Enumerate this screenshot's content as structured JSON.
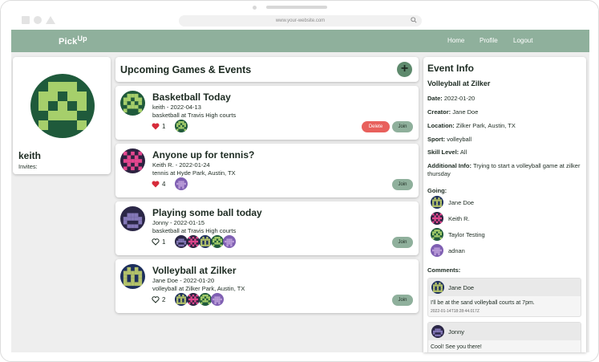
{
  "browser": {
    "url": "www.your-website.com"
  },
  "nav": {
    "brand": "Pick",
    "brand_sup": "Up",
    "links": [
      "Home",
      "Profile",
      "Logout"
    ]
  },
  "profile": {
    "name": "keith",
    "invites_label": "Invites:"
  },
  "feed": {
    "header": "Upcoming Games & Events",
    "add_label": "+",
    "games": [
      {
        "title": "Basketball Today",
        "meta": "keith - 2022-04-13",
        "location": "basketball at Travis High courts",
        "likes": "1",
        "liked": true,
        "can_delete": true,
        "avatar": "green"
      },
      {
        "title": "Anyone up for tennis?",
        "meta": "Keith R. - 2022-01-24",
        "location": "tennis at Hyde Park, Austin, TX",
        "likes": "4",
        "liked": true,
        "can_delete": false,
        "avatar": "pink"
      },
      {
        "title": "Playing some ball today",
        "meta": "Jonny - 2022-01-15",
        "location": "basketball at Travis High courts",
        "likes": "1",
        "liked": false,
        "can_delete": false,
        "avatar": "purple"
      },
      {
        "title": "Volleyball at Zilker",
        "meta": "Jane Doe - 2022-01-20",
        "location": "volleyball at Zilker Park, Austin, TX",
        "likes": "2",
        "liked": false,
        "can_delete": false,
        "avatar": "navy"
      }
    ],
    "delete_label": "Delete",
    "join_label": "Join"
  },
  "event_info": {
    "heading": "Event Info",
    "title": "Volleyball at Zilker",
    "date_label": "Date:",
    "date": "2022-01-20",
    "creator_label": "Creator:",
    "creator": "Jane Doe",
    "location_label": "Location:",
    "location": "Zilker Park, Austin, TX",
    "sport_label": "Sport:",
    "sport": "volleyball",
    "skill_label": "Skill Level:",
    "skill": "All",
    "additional_label": "Additional Info:",
    "additional": "Trying to start a volleyball game at zilker thursday",
    "going_label": "Going:",
    "going": [
      "Jane Doe",
      "Keith R.",
      "Taylor Testing",
      "adnan"
    ],
    "comments_label": "Comments:",
    "comments": [
      {
        "author": "Jane Doe",
        "text": "I'll be at the sand volleyball courts at 7pm.",
        "time": "2022-01-14T18:28:44.017Z"
      },
      {
        "author": "Jonny",
        "text": "Cool! See you there!",
        "time": ""
      }
    ]
  },
  "colors": {
    "navbar": "#8fb09c",
    "join": "#8fb09c",
    "delete": "#e8605c",
    "add": "#5e8a6d",
    "heart": "#d62b3a"
  }
}
